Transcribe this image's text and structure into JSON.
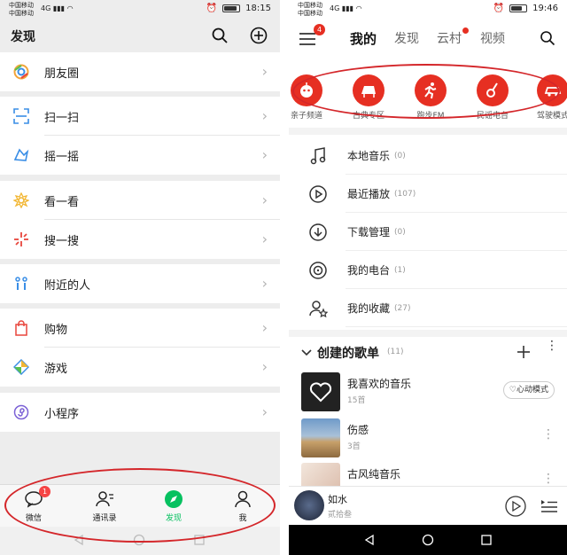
{
  "left": {
    "status": {
      "carrier1": "中国移动",
      "carrier2": "中国移动",
      "net": "4G",
      "time": "18:15"
    },
    "title": "发现",
    "items": [
      {
        "label": "朋友圈",
        "icon": "moments-icon"
      },
      {
        "label": "扫一扫",
        "icon": "scan-icon"
      },
      {
        "label": "摇一摇",
        "icon": "shake-icon"
      },
      {
        "label": "看一看",
        "icon": "look-icon"
      },
      {
        "label": "搜一搜",
        "icon": "search-star-icon"
      },
      {
        "label": "附近的人",
        "icon": "nearby-icon"
      },
      {
        "label": "购物",
        "icon": "shopping-icon"
      },
      {
        "label": "游戏",
        "icon": "game-icon"
      },
      {
        "label": "小程序",
        "icon": "mini-program-icon"
      }
    ],
    "tabs": [
      {
        "label": "微信",
        "badge": "1"
      },
      {
        "label": "通讯录"
      },
      {
        "label": "发现"
      },
      {
        "label": "我"
      }
    ],
    "accent": "#07c160"
  },
  "right": {
    "status": {
      "carrier1": "中国移动",
      "carrier2": "中国移动",
      "net": "4G",
      "time": "19:46"
    },
    "menu_badge": "4",
    "tabs": [
      "我的",
      "发现",
      "云村",
      "视频"
    ],
    "channels": [
      "亲子频道",
      "古典专区",
      "跑步FM",
      "民谣电台",
      "驾驶模式"
    ],
    "rows": [
      {
        "label": "本地音乐",
        "count": "(0)"
      },
      {
        "label": "最近播放",
        "count": "(107)"
      },
      {
        "label": "下载管理",
        "count": "(0)"
      },
      {
        "label": "我的电台",
        "count": "(1)"
      },
      {
        "label": "我的收藏",
        "count": "(27)"
      }
    ],
    "section": {
      "title": "创建的歌单",
      "count": "(11)"
    },
    "playlists": [
      {
        "name": "我喜欢的音乐",
        "sub": "15首",
        "button": "心动模式"
      },
      {
        "name": "伤感",
        "sub": "3首"
      },
      {
        "name": "古风纯音乐",
        "sub": ""
      }
    ],
    "player": {
      "song": "如水",
      "artist": "贰拾叁"
    },
    "accent": "#e62f22"
  }
}
